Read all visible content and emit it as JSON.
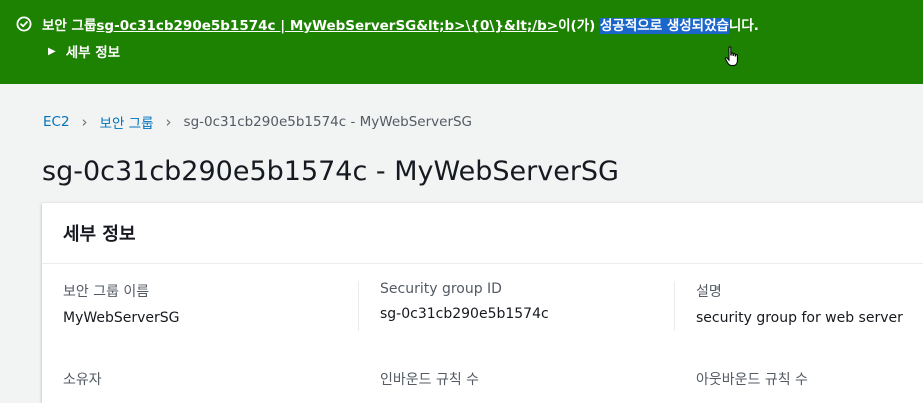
{
  "flash": {
    "prefix": "보안 그룹",
    "link_text": "sg-0c31cb290e5b1574c | MyWebServerSG&lt;b>\\{0\\}&lt;/b>",
    "middle": "이(가) ",
    "highlight": "성공적으로 생성되었습",
    "suffix": "니다.",
    "details_label": "세부 정보",
    "color": "#1d8102"
  },
  "breadcrumb": {
    "items": [
      "EC2",
      "보안 그룹"
    ],
    "current": "sg-0c31cb290e5b1574c - MyWebServerSG"
  },
  "page": {
    "title": "sg-0c31cb290e5b1574c - MyWebServerSG"
  },
  "details": {
    "title": "세부 정보",
    "fields": [
      {
        "label": "보안 그룹 이름",
        "value": "MyWebServerSG"
      },
      {
        "label": "Security group ID",
        "value": "sg-0c31cb290e5b1574c"
      },
      {
        "label": "설명",
        "value": "security group for web server"
      }
    ],
    "row2_labels": [
      "소유자",
      "인바운드 규칙 수",
      "아웃바운드 규칙 수"
    ]
  }
}
